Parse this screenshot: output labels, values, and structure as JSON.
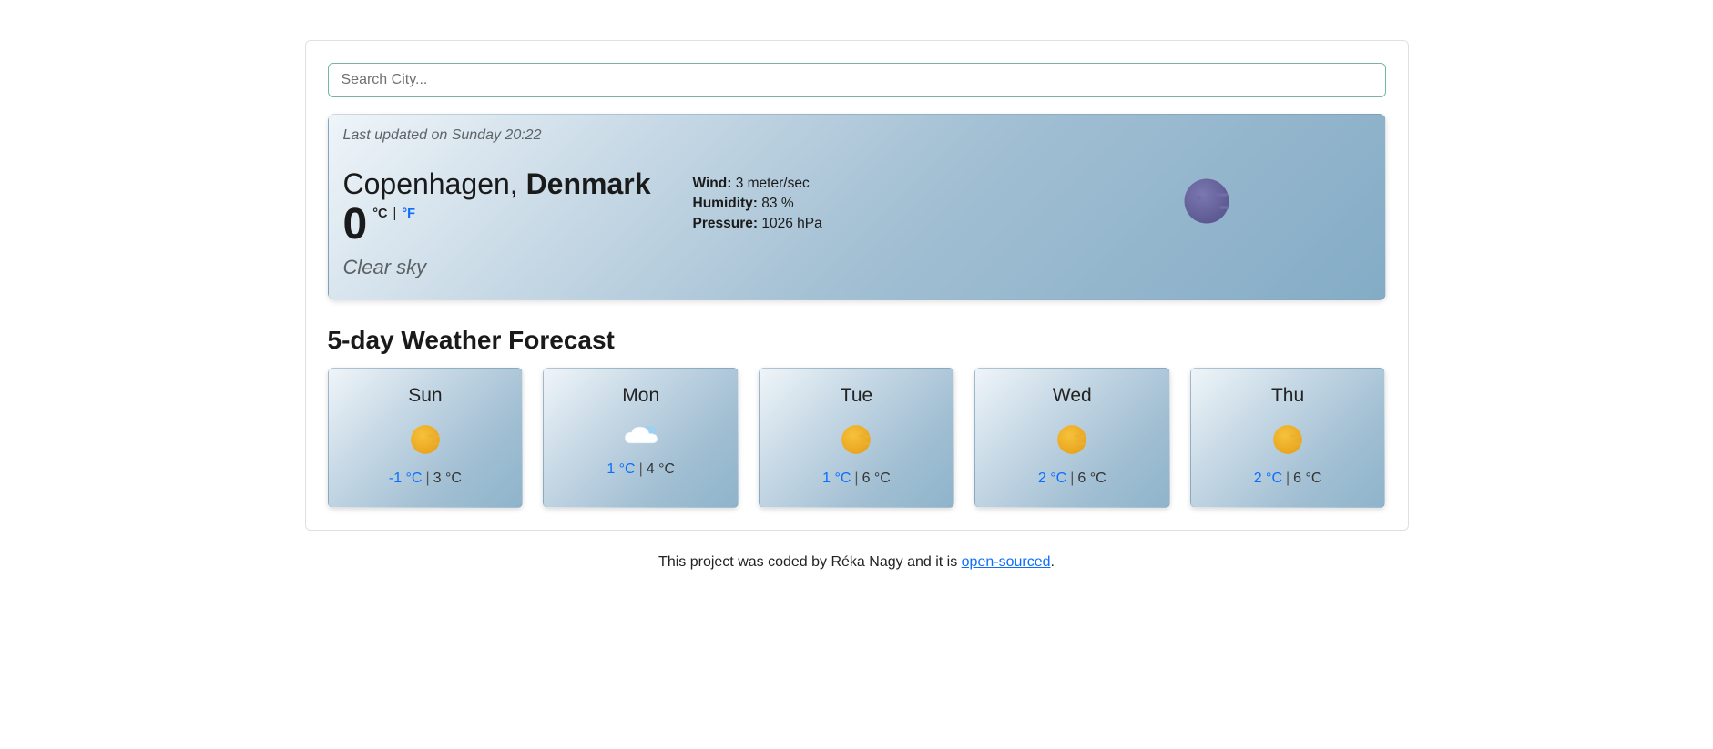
{
  "search": {
    "placeholder": "Search City..."
  },
  "current": {
    "last_updated": "Last updated on Sunday 20:22",
    "city": "Copenhagen,",
    "country": "Denmark",
    "temp": "0",
    "unit_c": "°C",
    "unit_sep": "|",
    "unit_f": "°F",
    "condition": "Clear sky",
    "wind_label": "Wind:",
    "wind_value": "3 meter/sec",
    "humidity_label": "Humidity:",
    "humidity_value": "83 %",
    "pressure_label": "Pressure:",
    "pressure_value": "1026 hPa"
  },
  "forecast": {
    "title": "5-day Weather Forecast",
    "days": [
      {
        "name": "Sun",
        "icon": "sun",
        "lo": "-1 °C",
        "hi": "3 °C"
      },
      {
        "name": "Mon",
        "icon": "cloud",
        "lo": "1 °C",
        "hi": "4 °C"
      },
      {
        "name": "Tue",
        "icon": "sun",
        "lo": "1 °C",
        "hi": "6 °C"
      },
      {
        "name": "Wed",
        "icon": "sun",
        "lo": "2 °C",
        "hi": "6 °C"
      },
      {
        "name": "Thu",
        "icon": "sun",
        "lo": "2 °C",
        "hi": "6 °C"
      }
    ]
  },
  "footer": {
    "prefix": "This project was coded by Réka Nagy and it is ",
    "link_text": "open-sourced",
    "suffix": "."
  }
}
